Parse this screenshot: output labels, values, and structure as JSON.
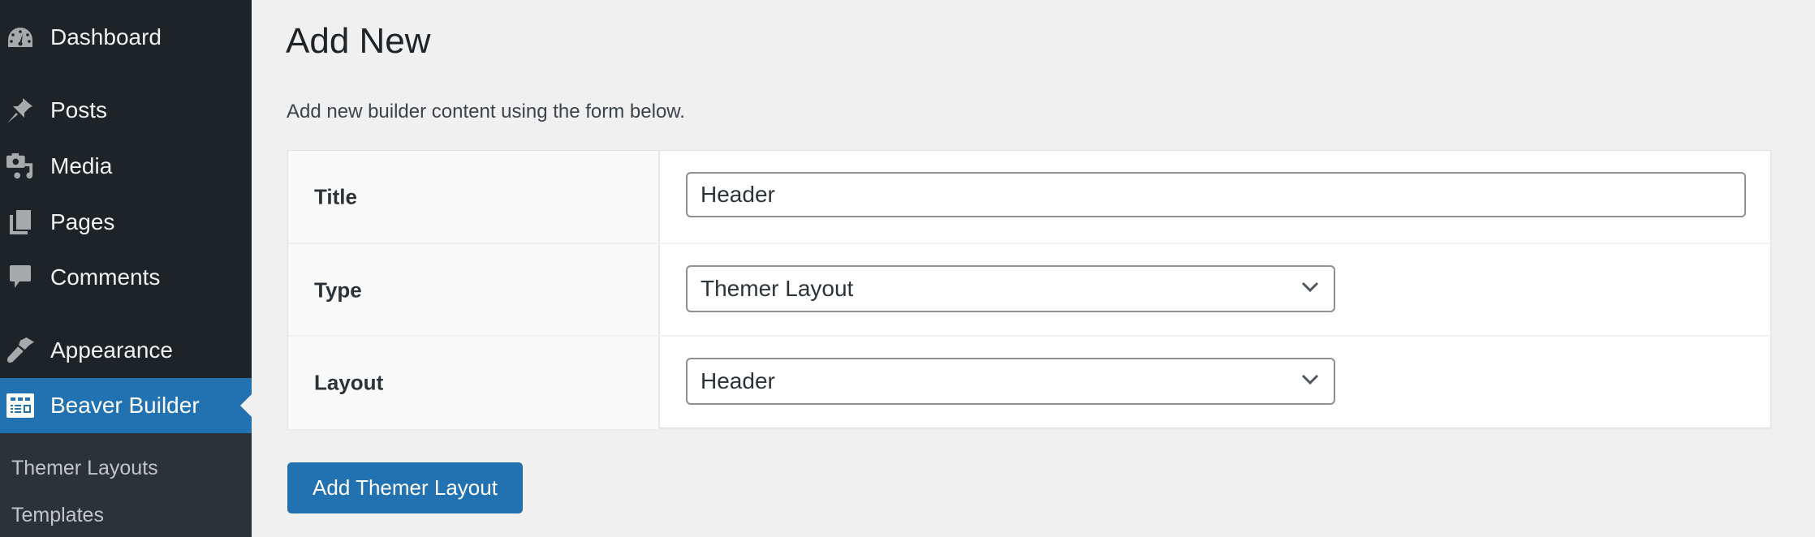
{
  "sidebar": {
    "items": [
      {
        "label": "Dashboard",
        "icon": "dashboard-icon"
      },
      {
        "label": "Posts",
        "icon": "pin-icon"
      },
      {
        "label": "Media",
        "icon": "media-icon"
      },
      {
        "label": "Pages",
        "icon": "pages-icon"
      },
      {
        "label": "Comments",
        "icon": "comment-icon"
      },
      {
        "label": "Appearance",
        "icon": "paintbrush-icon"
      },
      {
        "label": "Beaver Builder",
        "icon": "layout-icon",
        "active": true
      }
    ],
    "submenu": [
      {
        "label": "Themer Layouts"
      },
      {
        "label": "Templates"
      }
    ],
    "active_color": "#2271b1"
  },
  "main": {
    "title": "Add New",
    "description": "Add new builder content using the form below.",
    "form": {
      "title_label": "Title",
      "title_value": "Header",
      "type_label": "Type",
      "type_value": "Themer Layout",
      "layout_label": "Layout",
      "layout_value": "Header"
    },
    "submit_label": "Add Themer Layout"
  }
}
